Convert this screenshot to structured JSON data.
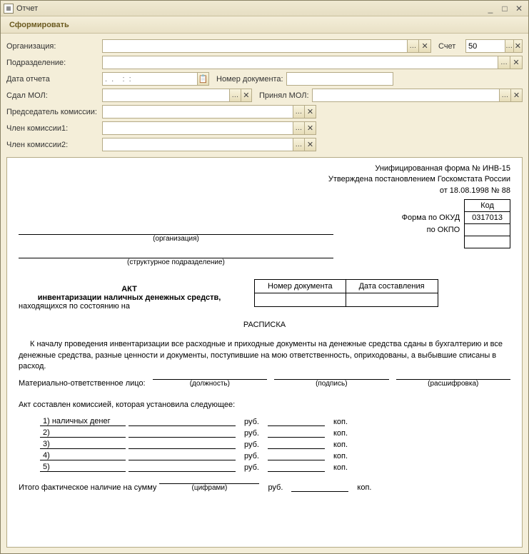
{
  "window": {
    "title": "Отчет"
  },
  "toolbar": {
    "form_btn": "Сформировать"
  },
  "labels": {
    "org": "Организация:",
    "dept": "Подразделение:",
    "date": "Дата отчета",
    "docnum": "Номер документа:",
    "sdal": "Сдал МОЛ:",
    "prinal": "Принял МОЛ:",
    "chairman": "Председатель комиссии:",
    "member1": "Член комиссии1:",
    "member2": "Член комиссии2:",
    "account": "Счет"
  },
  "values": {
    "account": "50",
    "date_placeholder": ".  .    :  :"
  },
  "doc": {
    "form_line1": "Унифицированная форма № ИНВ-15",
    "form_line2": "Утверждена постановлением Госкомстата России",
    "form_line3": "от 18.08.1998 № 88",
    "kod_head": "Код",
    "okud_label": "Форма по ОКУД",
    "okud_value": "0317013",
    "okpo_label": "по ОКПО",
    "org_sub": "(организация)",
    "struct_sub": "(структурное подразделение)",
    "mini_h1": "Номер документа",
    "mini_h2": "Дата составления",
    "act": "АКТ",
    "act_sub": "инвентаризации наличных денежных средств,",
    "act_sub2": "находящихся по состоянию на",
    "raspiska": "РАСПИСКА",
    "para": "К началу проведения инвентаризации все расходные и приходные документы на денежные средства сданы в бухгалтерию и все денежные средства, разные ценности и документы, поступившие на мою ответственность, оприходованы, а выбывшие списаны в расход.",
    "mol_label": "Материально-ответственное лицо:",
    "sub_pos": "(должность)",
    "sub_sign": "(подпись)",
    "sub_name": "(расшифровка)",
    "commission_line": "Акт составлен комиссией, которая установила следующее:",
    "rows": [
      "1) наличных денег",
      "2)",
      "3)",
      "4)",
      "5)"
    ],
    "rub": "руб.",
    "kop": "коп.",
    "total": "Итого фактическое наличие на сумму",
    "total_sub": "(цифрами)"
  }
}
